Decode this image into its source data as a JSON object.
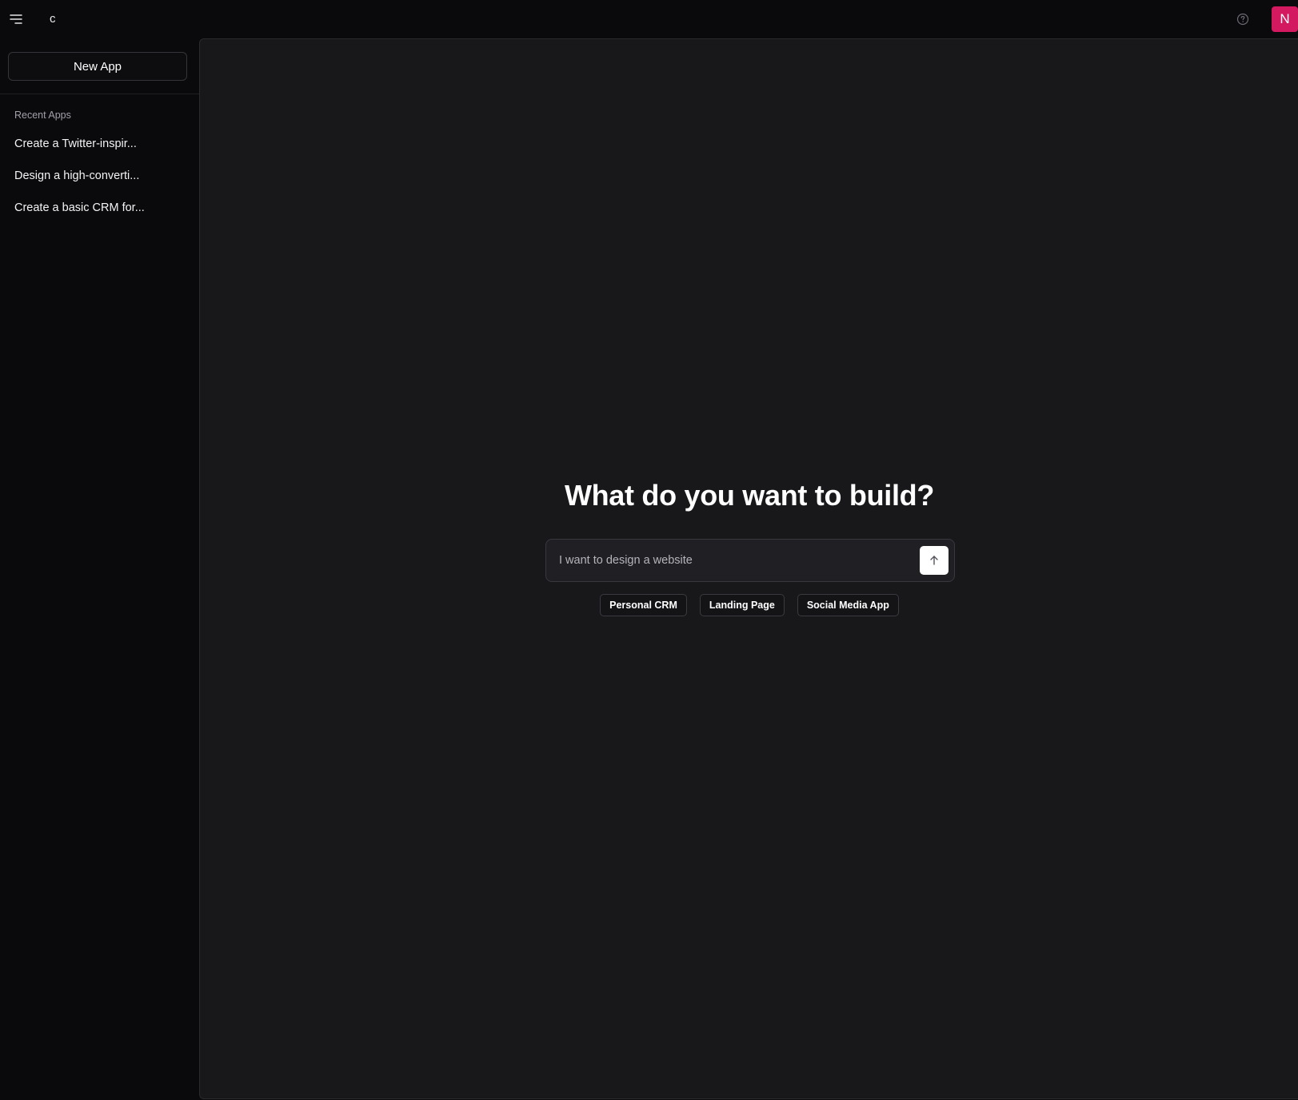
{
  "header": {
    "brand": "c",
    "avatar_initial": "N",
    "avatar_color": "#d3195f",
    "icons": {
      "menu": "menu-icon",
      "help": "help-circle-icon"
    }
  },
  "sidebar": {
    "new_app_label": "New App",
    "recent_label": "Recent Apps",
    "recent_items": [
      {
        "label": "Create a Twitter-inspir..."
      },
      {
        "label": "Design a high-converti..."
      },
      {
        "label": "Create a basic CRM for..."
      }
    ]
  },
  "main": {
    "headline": "What do you want to build?",
    "prompt": {
      "value": "I want to design a website",
      "placeholder": ""
    },
    "send_icon": "arrow-up-icon",
    "suggestions": [
      {
        "label": "Personal CRM"
      },
      {
        "label": "Landing Page"
      },
      {
        "label": "Social Media App"
      }
    ]
  }
}
